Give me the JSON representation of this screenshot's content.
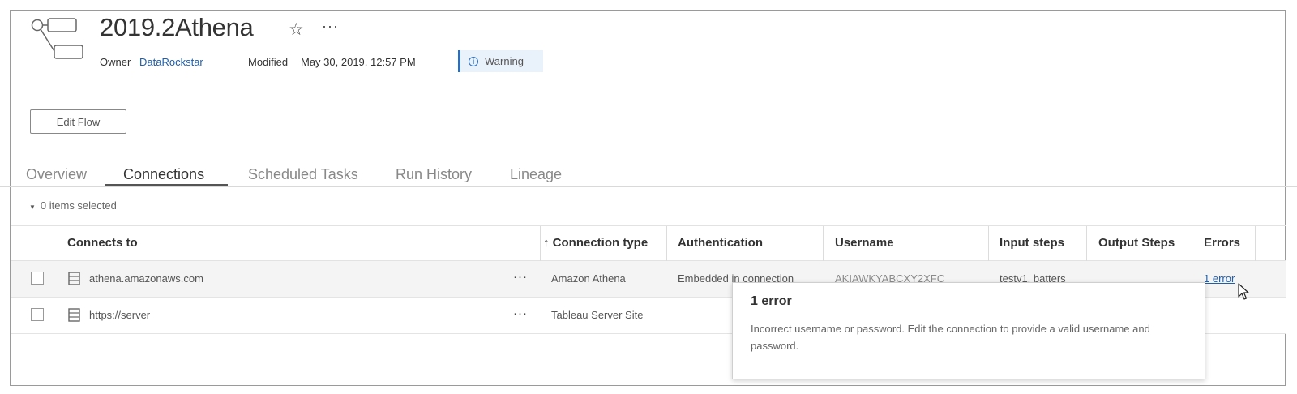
{
  "header": {
    "title": "2019.2Athena",
    "star_icon": "☆",
    "more_icon": "···",
    "owner_label": "Owner",
    "owner_value": "DataRockstar",
    "modified_label": "Modified",
    "modified_value": "May 30, 2019, 12:57 PM",
    "warning_label": "Warning",
    "info_icon": "i"
  },
  "actions": {
    "edit_flow_label": "Edit Flow"
  },
  "tabs": [
    {
      "label": "Overview",
      "active": false
    },
    {
      "label": "Connections",
      "active": true
    },
    {
      "label": "Scheduled Tasks",
      "active": false
    },
    {
      "label": "Run History",
      "active": false
    },
    {
      "label": "Lineage",
      "active": false
    }
  ],
  "selection": {
    "caret": "▼",
    "text": "0 items selected"
  },
  "table": {
    "columns": [
      "Connects to",
      "↑ Connection type",
      "Authentication",
      "Username",
      "Input steps",
      "Output Steps",
      "Errors"
    ],
    "rows": [
      {
        "connects_to": "athena.amazonaws.com",
        "more": "···",
        "connection_type": "Amazon Athena",
        "authentication": "Embedded in connection",
        "username": "AKIAWKYABCXY2XFC",
        "input_steps": "testy1, batters",
        "output_steps": "",
        "errors": "1 error"
      },
      {
        "connects_to": "https://server",
        "more": "···",
        "connection_type": "Tableau Server Site",
        "authentication": "",
        "username": "",
        "input_steps": "",
        "output_steps": "",
        "errors": ""
      }
    ]
  },
  "tooltip": {
    "title": "1 error",
    "body": "Incorrect username or password. Edit the connection to provide a valid username and password."
  },
  "colors": {
    "link": "#1f5ea8",
    "warning_accent": "#2a6ebd",
    "warning_bg": "#e9f1fa"
  }
}
